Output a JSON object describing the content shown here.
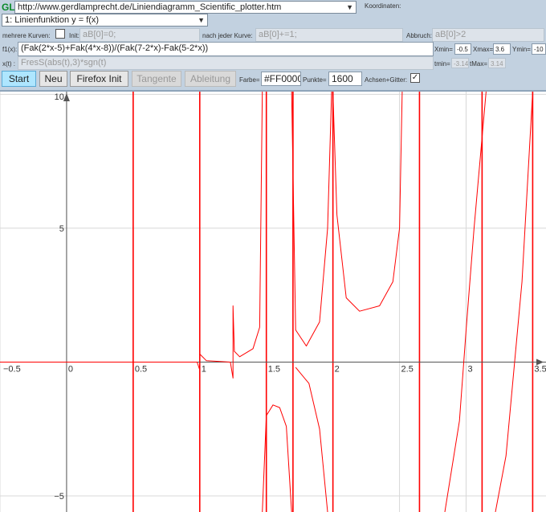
{
  "header": {
    "logo": "GL",
    "url_select": "http://www.gerdlamprecht.de/Liniendiagramm_Scientific_plotter.htm",
    "coords_label": "Koordinaten:",
    "mode_select": "1: Linienfunktion y = f(x)"
  },
  "row_multi": {
    "multi_label": "mehrere Kurven:",
    "multi_checked": false,
    "init_label": "Init:",
    "init_value": "aB[0]=0;",
    "after_label": "nach jeder Kurve:",
    "after_value": "aB[0]+=1;",
    "abort_label": "Abbruch:",
    "abort_value": "aB[0]>2"
  },
  "row_func": {
    "f1_label": "f1(x):",
    "f1_value": "(Fak(2*x-5)+Fak(4*x-8))/(Fak(7-2*x)-Fak(5-2*x))",
    "xmin_label": "Xmin=",
    "xmin_value": "-0.5",
    "xmax_label": "Xmax=",
    "xmax_value": "3.6",
    "ymin_label": "Ymin=",
    "ymin_value": "-10"
  },
  "row_param": {
    "xt_label": "x(t) :",
    "xt_value": "FresS(abs(t),3)*sgn(t)",
    "tmin_label": "tmin=",
    "tmin_value": "-3.14",
    "tmax_label": "tMax=",
    "tmax_value": "3.14"
  },
  "buttons": {
    "start": "Start",
    "neu": "Neu",
    "firefox_init": "Firefox Init",
    "tangente": "Tangente",
    "ableitung": "Ableitung"
  },
  "options": {
    "color_label": "Farbe=",
    "color_value": "#FF0000",
    "points_label": "Punkte=",
    "points_value": "1600",
    "axes_grid_label": "Achsen+Gitter:",
    "axes_grid_checked": true
  },
  "chart_data": {
    "type": "line",
    "function": "(Fak(2*x-5)+Fak(4*x-8))/(Fak(7-2*x)-Fak(5-2*x))",
    "x_tick_labels": [
      "−0.5",
      "0",
      "0.5",
      "1",
      "1.5",
      "2",
      "2.5",
      "3",
      "3.5"
    ],
    "y_tick_labels": [
      "10",
      "5",
      "−5"
    ],
    "xlim": [
      -0.5,
      3.6
    ],
    "ylim": [
      -5.6,
      10.1
    ],
    "grid": true,
    "line_color": "#FF0000",
    "grid_color": "#d8d8d8",
    "series": [
      {
        "values": [
          [
            -0.5,
            0
          ],
          [
            0.98,
            0
          ],
          [
            1.0,
            -0.3
          ],
          [
            1.0,
            10.1
          ]
        ]
      },
      {
        "values": [
          [
            1.0,
            10.1
          ],
          [
            1.0,
            0.3
          ],
          [
            1.05,
            0.05
          ],
          [
            1.23,
            0
          ],
          [
            1.25,
            -0.6
          ],
          [
            1.25,
            2.1
          ],
          [
            1.26,
            0.4
          ],
          [
            1.3,
            0.2
          ],
          [
            1.4,
            0.5
          ],
          [
            1.45,
            1.3
          ],
          [
            1.47,
            10.1
          ]
        ]
      },
      {
        "values": [
          [
            1.47,
            -5.6
          ],
          [
            1.5,
            -2.0
          ],
          [
            1.55,
            -1.6
          ],
          [
            1.6,
            -1.7
          ],
          [
            1.65,
            -2.4
          ],
          [
            1.69,
            -5.6
          ]
        ]
      },
      {
        "values": [
          [
            1.69,
            10.1
          ],
          [
            1.72,
            1.2
          ],
          [
            1.8,
            0.6
          ],
          [
            1.9,
            1.5
          ],
          [
            1.96,
            5.0
          ],
          [
            1.99,
            10.1
          ]
        ]
      },
      {
        "values": [
          [
            1.72,
            -0.2
          ],
          [
            1.82,
            -0.8
          ],
          [
            1.9,
            -2.5
          ],
          [
            1.96,
            -5.6
          ]
        ]
      },
      {
        "values": [
          [
            2.0,
            10.1
          ],
          [
            2.03,
            5.5
          ],
          [
            2.1,
            2.4
          ],
          [
            2.2,
            1.9
          ],
          [
            2.35,
            2.1
          ],
          [
            2.45,
            3.0
          ],
          [
            2.5,
            5.0
          ],
          [
            2.52,
            10.1
          ]
        ]
      },
      {
        "values": [
          [
            2.84,
            -5.6
          ],
          [
            2.95,
            -2.2
          ],
          [
            3.0,
            1.2
          ],
          [
            3.06,
            5.0
          ],
          [
            3.15,
            10.1
          ]
        ]
      },
      {
        "values": [
          [
            3.22,
            -5.6
          ],
          [
            3.3,
            -3.5
          ],
          [
            3.42,
            3.0
          ],
          [
            3.5,
            10.1
          ]
        ]
      }
    ],
    "asymptotes_x": [
      0.5,
      1.0,
      1.5,
      1.7,
      2.0,
      2.65,
      3.12,
      3.5
    ]
  }
}
